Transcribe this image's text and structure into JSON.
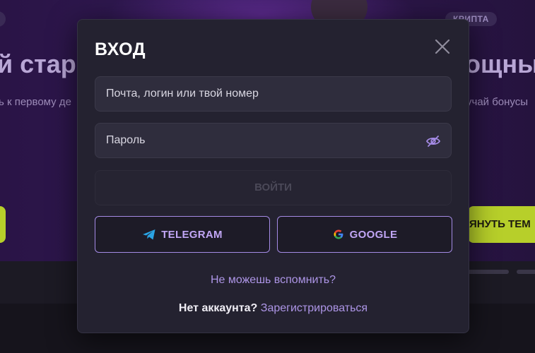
{
  "background": {
    "headline_left": "й стар",
    "headline_right": "ощны",
    "subtitle_left": "ь к первому де",
    "subtitle_right": "учай бонусы",
    "badge": "КРИПТА",
    "cta_right": "ЯНУТЬ ТЕМ"
  },
  "modal": {
    "title": "ВХОД",
    "login_placeholder": "Почта, логин или твой номер",
    "password_placeholder": "Пароль",
    "submit_label": "ВОЙТИ",
    "telegram_label": "TELEGRAM",
    "google_label": "GOOGLE",
    "forgot_link": "Не можешь вспомнить?",
    "no_account_text": "Нет аккаунта?",
    "register_link": "Зарегистрироваться"
  },
  "colors": {
    "accent": "#a58be6",
    "modal_bg": "#242230",
    "telegram_blue": "#2aa3e3"
  },
  "icons": [
    "close-icon",
    "eye-off-icon",
    "telegram-icon",
    "google-icon"
  ]
}
